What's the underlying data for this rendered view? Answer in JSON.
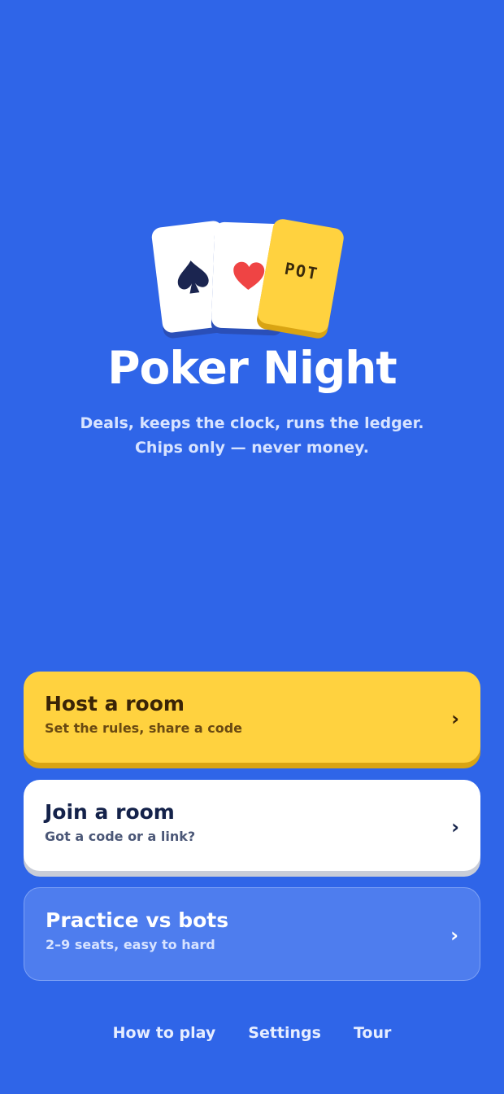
{
  "app": {
    "title": "Poker Night",
    "subtitle_line1": "Deals, keeps the clock, runs the ledger.",
    "subtitle_line2": "Chips only — never money."
  },
  "hero": {
    "cards": [
      {
        "icon": "spade-icon",
        "color": "#1B2550"
      },
      {
        "icon": "heart-icon",
        "color": "#EF4444"
      },
      {
        "label": "POT"
      }
    ]
  },
  "actions": [
    {
      "label": "Host a room",
      "sub": "Set the rules, share a code",
      "chevron": "›"
    },
    {
      "label": "Join a room",
      "sub": "Got a code or a link?",
      "chevron": "›"
    },
    {
      "label": "Practice vs bots",
      "sub": "2–9 seats, easy to hard",
      "chevron": "›"
    }
  ],
  "footer": {
    "links": [
      "How to play",
      "Settings",
      "Tour"
    ]
  },
  "colors": {
    "background": "#2F65E8",
    "host": "#FFD23F",
    "join": "#FFFFFF",
    "practice": "#4E7DEE"
  }
}
